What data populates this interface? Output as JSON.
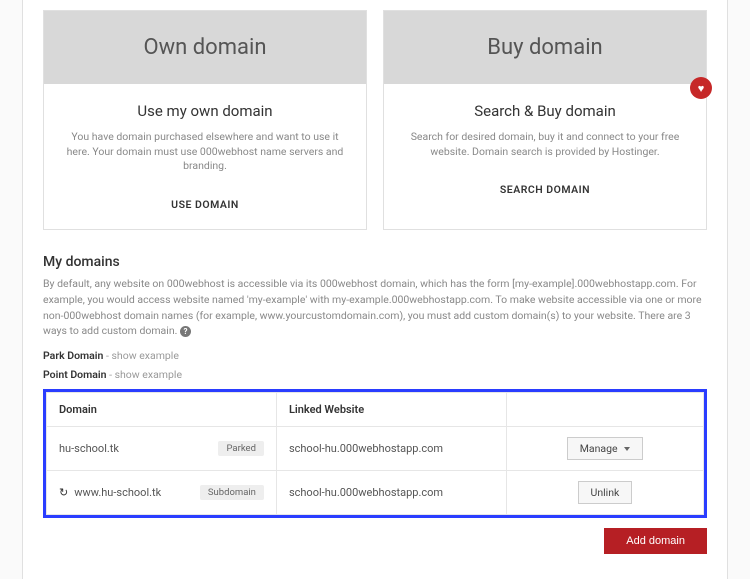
{
  "cards": {
    "own": {
      "header": "Own domain",
      "title": "Use my own domain",
      "desc": "You have domain purchased elsewhere and want to use it here. Your domain must use 000webhost name servers and branding.",
      "action": "USE DOMAIN"
    },
    "buy": {
      "header": "Buy domain",
      "title": "Search & Buy domain",
      "desc": "Search for desired domain, buy it and connect to your free website. Domain search is provided by Hostinger.",
      "action": "SEARCH DOMAIN"
    }
  },
  "mydomains": {
    "title": "My domains",
    "desc": "By default, any website on 000webhost is accessible via its 000webhost domain, which has the form [my-example].000webhostapp.com. For example, you would access website named 'my-example' with my-example.000webhostapp.com. To make website accessible via one or more non-000webhost domain names (for example, www.yourcustomdomain.com), you must add custom domain(s) to your website. There are 3 ways to add custom domain.",
    "park": {
      "label": "Park Domain",
      "sep": " - ",
      "link": "show example"
    },
    "point": {
      "label": "Point Domain",
      "sep": " - ",
      "link": "show example"
    }
  },
  "table": {
    "headers": {
      "domain": "Domain",
      "linked": "Linked Website",
      "actions": ""
    },
    "rows": [
      {
        "domain": "hu-school.tk",
        "tag": "Parked",
        "icon": false,
        "linked": "school-hu.000webhostapp.com",
        "action": "Manage",
        "caret": true
      },
      {
        "domain": "www.hu-school.tk",
        "tag": "Subdomain",
        "icon": true,
        "linked": "school-hu.000webhostapp.com",
        "action": "Unlink",
        "caret": false
      }
    ]
  },
  "buttons": {
    "add": "Add domain"
  }
}
